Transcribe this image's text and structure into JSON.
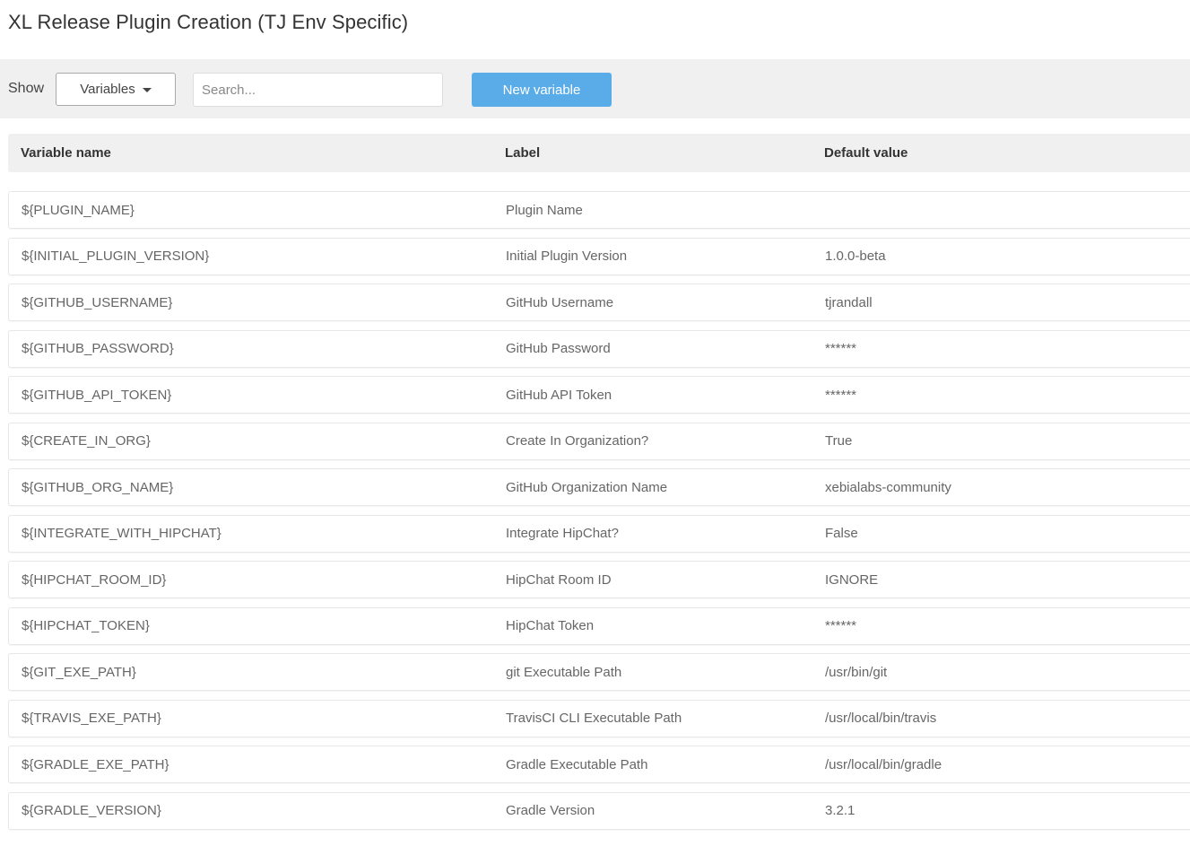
{
  "page": {
    "title": "XL Release Plugin Creation (TJ Env Specific)"
  },
  "toolbar": {
    "show_label": "Show",
    "show_select_value": "Variables",
    "search_placeholder": "Search...",
    "new_button_label": "New variable"
  },
  "colors": {
    "accent": "#5aace8",
    "toolbar_bg": "#f0f0f0",
    "row_border": "#e7e7e7"
  },
  "table": {
    "columns": [
      "Variable name",
      "Label",
      "Default value"
    ],
    "rows": [
      {
        "name": "${PLUGIN_NAME}",
        "label": "Plugin Name",
        "default": ""
      },
      {
        "name": "${INITIAL_PLUGIN_VERSION}",
        "label": "Initial Plugin Version",
        "default": "1.0.0-beta"
      },
      {
        "name": "${GITHUB_USERNAME}",
        "label": "GitHub Username",
        "default": "tjrandall"
      },
      {
        "name": "${GITHUB_PASSWORD}",
        "label": "GitHub Password",
        "default": "******"
      },
      {
        "name": "${GITHUB_API_TOKEN}",
        "label": "GitHub API Token",
        "default": "******"
      },
      {
        "name": "${CREATE_IN_ORG}",
        "label": "Create In Organization?",
        "default": "True"
      },
      {
        "name": "${GITHUB_ORG_NAME}",
        "label": "GitHub Organization Name",
        "default": "xebialabs-community"
      },
      {
        "name": "${INTEGRATE_WITH_HIPCHAT}",
        "label": "Integrate HipChat?",
        "default": "False"
      },
      {
        "name": "${HIPCHAT_ROOM_ID}",
        "label": "HipChat Room ID",
        "default": "IGNORE"
      },
      {
        "name": "${HIPCHAT_TOKEN}",
        "label": "HipChat Token",
        "default": "******"
      },
      {
        "name": "${GIT_EXE_PATH}",
        "label": "git Executable Path",
        "default": "/usr/bin/git"
      },
      {
        "name": "${TRAVIS_EXE_PATH}",
        "label": "TravisCI CLI Executable Path",
        "default": "/usr/local/bin/travis"
      },
      {
        "name": "${GRADLE_EXE_PATH}",
        "label": "Gradle Executable Path",
        "default": "/usr/local/bin/gradle"
      },
      {
        "name": "${GRADLE_VERSION}",
        "label": "Gradle Version",
        "default": "3.2.1"
      }
    ]
  }
}
